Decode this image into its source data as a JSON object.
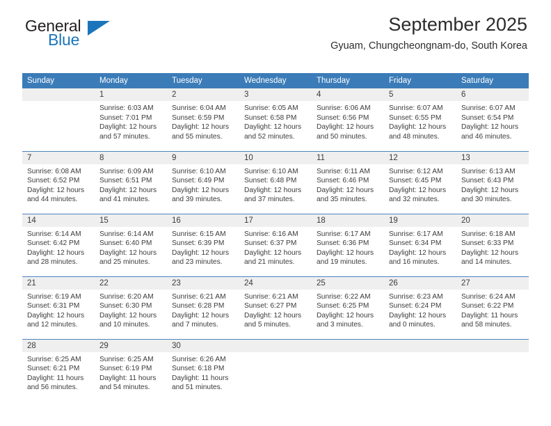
{
  "logo": {
    "word_one": "General",
    "word_two": "Blue",
    "triangle_icon": "triangle-icon",
    "brand_blue": "#1b75bb",
    "brand_dark": "#231f20"
  },
  "header": {
    "title": "September 2025",
    "subtitle": "Gyuam, Chungcheongnam-do, South Korea",
    "accent_color": "#3b7cb8",
    "daynum_band_color": "#efefef"
  },
  "weekday_headers": [
    "Sunday",
    "Monday",
    "Tuesday",
    "Wednesday",
    "Thursday",
    "Friday",
    "Saturday"
  ],
  "weeks": [
    [
      {
        "day": "",
        "sunrise": "",
        "sunset": "",
        "daylight_line1": "",
        "daylight_line2": "",
        "empty": true
      },
      {
        "day": "1",
        "sunrise": "Sunrise: 6:03 AM",
        "sunset": "Sunset: 7:01 PM",
        "daylight_line1": "Daylight: 12 hours",
        "daylight_line2": "and 57 minutes."
      },
      {
        "day": "2",
        "sunrise": "Sunrise: 6:04 AM",
        "sunset": "Sunset: 6:59 PM",
        "daylight_line1": "Daylight: 12 hours",
        "daylight_line2": "and 55 minutes."
      },
      {
        "day": "3",
        "sunrise": "Sunrise: 6:05 AM",
        "sunset": "Sunset: 6:58 PM",
        "daylight_line1": "Daylight: 12 hours",
        "daylight_line2": "and 52 minutes."
      },
      {
        "day": "4",
        "sunrise": "Sunrise: 6:06 AM",
        "sunset": "Sunset: 6:56 PM",
        "daylight_line1": "Daylight: 12 hours",
        "daylight_line2": "and 50 minutes."
      },
      {
        "day": "5",
        "sunrise": "Sunrise: 6:07 AM",
        "sunset": "Sunset: 6:55 PM",
        "daylight_line1": "Daylight: 12 hours",
        "daylight_line2": "and 48 minutes."
      },
      {
        "day": "6",
        "sunrise": "Sunrise: 6:07 AM",
        "sunset": "Sunset: 6:54 PM",
        "daylight_line1": "Daylight: 12 hours",
        "daylight_line2": "and 46 minutes."
      }
    ],
    [
      {
        "day": "7",
        "sunrise": "Sunrise: 6:08 AM",
        "sunset": "Sunset: 6:52 PM",
        "daylight_line1": "Daylight: 12 hours",
        "daylight_line2": "and 44 minutes."
      },
      {
        "day": "8",
        "sunrise": "Sunrise: 6:09 AM",
        "sunset": "Sunset: 6:51 PM",
        "daylight_line1": "Daylight: 12 hours",
        "daylight_line2": "and 41 minutes."
      },
      {
        "day": "9",
        "sunrise": "Sunrise: 6:10 AM",
        "sunset": "Sunset: 6:49 PM",
        "daylight_line1": "Daylight: 12 hours",
        "daylight_line2": "and 39 minutes."
      },
      {
        "day": "10",
        "sunrise": "Sunrise: 6:10 AM",
        "sunset": "Sunset: 6:48 PM",
        "daylight_line1": "Daylight: 12 hours",
        "daylight_line2": "and 37 minutes."
      },
      {
        "day": "11",
        "sunrise": "Sunrise: 6:11 AM",
        "sunset": "Sunset: 6:46 PM",
        "daylight_line1": "Daylight: 12 hours",
        "daylight_line2": "and 35 minutes."
      },
      {
        "day": "12",
        "sunrise": "Sunrise: 6:12 AM",
        "sunset": "Sunset: 6:45 PM",
        "daylight_line1": "Daylight: 12 hours",
        "daylight_line2": "and 32 minutes."
      },
      {
        "day": "13",
        "sunrise": "Sunrise: 6:13 AM",
        "sunset": "Sunset: 6:43 PM",
        "daylight_line1": "Daylight: 12 hours",
        "daylight_line2": "and 30 minutes."
      }
    ],
    [
      {
        "day": "14",
        "sunrise": "Sunrise: 6:14 AM",
        "sunset": "Sunset: 6:42 PM",
        "daylight_line1": "Daylight: 12 hours",
        "daylight_line2": "and 28 minutes."
      },
      {
        "day": "15",
        "sunrise": "Sunrise: 6:14 AM",
        "sunset": "Sunset: 6:40 PM",
        "daylight_line1": "Daylight: 12 hours",
        "daylight_line2": "and 25 minutes."
      },
      {
        "day": "16",
        "sunrise": "Sunrise: 6:15 AM",
        "sunset": "Sunset: 6:39 PM",
        "daylight_line1": "Daylight: 12 hours",
        "daylight_line2": "and 23 minutes."
      },
      {
        "day": "17",
        "sunrise": "Sunrise: 6:16 AM",
        "sunset": "Sunset: 6:37 PM",
        "daylight_line1": "Daylight: 12 hours",
        "daylight_line2": "and 21 minutes."
      },
      {
        "day": "18",
        "sunrise": "Sunrise: 6:17 AM",
        "sunset": "Sunset: 6:36 PM",
        "daylight_line1": "Daylight: 12 hours",
        "daylight_line2": "and 19 minutes."
      },
      {
        "day": "19",
        "sunrise": "Sunrise: 6:17 AM",
        "sunset": "Sunset: 6:34 PM",
        "daylight_line1": "Daylight: 12 hours",
        "daylight_line2": "and 16 minutes."
      },
      {
        "day": "20",
        "sunrise": "Sunrise: 6:18 AM",
        "sunset": "Sunset: 6:33 PM",
        "daylight_line1": "Daylight: 12 hours",
        "daylight_line2": "and 14 minutes."
      }
    ],
    [
      {
        "day": "21",
        "sunrise": "Sunrise: 6:19 AM",
        "sunset": "Sunset: 6:31 PM",
        "daylight_line1": "Daylight: 12 hours",
        "daylight_line2": "and 12 minutes."
      },
      {
        "day": "22",
        "sunrise": "Sunrise: 6:20 AM",
        "sunset": "Sunset: 6:30 PM",
        "daylight_line1": "Daylight: 12 hours",
        "daylight_line2": "and 10 minutes."
      },
      {
        "day": "23",
        "sunrise": "Sunrise: 6:21 AM",
        "sunset": "Sunset: 6:28 PM",
        "daylight_line1": "Daylight: 12 hours",
        "daylight_line2": "and 7 minutes."
      },
      {
        "day": "24",
        "sunrise": "Sunrise: 6:21 AM",
        "sunset": "Sunset: 6:27 PM",
        "daylight_line1": "Daylight: 12 hours",
        "daylight_line2": "and 5 minutes."
      },
      {
        "day": "25",
        "sunrise": "Sunrise: 6:22 AM",
        "sunset": "Sunset: 6:25 PM",
        "daylight_line1": "Daylight: 12 hours",
        "daylight_line2": "and 3 minutes."
      },
      {
        "day": "26",
        "sunrise": "Sunrise: 6:23 AM",
        "sunset": "Sunset: 6:24 PM",
        "daylight_line1": "Daylight: 12 hours",
        "daylight_line2": "and 0 minutes."
      },
      {
        "day": "27",
        "sunrise": "Sunrise: 6:24 AM",
        "sunset": "Sunset: 6:22 PM",
        "daylight_line1": "Daylight: 11 hours",
        "daylight_line2": "and 58 minutes."
      }
    ],
    [
      {
        "day": "28",
        "sunrise": "Sunrise: 6:25 AM",
        "sunset": "Sunset: 6:21 PM",
        "daylight_line1": "Daylight: 11 hours",
        "daylight_line2": "and 56 minutes."
      },
      {
        "day": "29",
        "sunrise": "Sunrise: 6:25 AM",
        "sunset": "Sunset: 6:19 PM",
        "daylight_line1": "Daylight: 11 hours",
        "daylight_line2": "and 54 minutes."
      },
      {
        "day": "30",
        "sunrise": "Sunrise: 6:26 AM",
        "sunset": "Sunset: 6:18 PM",
        "daylight_line1": "Daylight: 11 hours",
        "daylight_line2": "and 51 minutes."
      },
      {
        "day": "",
        "sunrise": "",
        "sunset": "",
        "daylight_line1": "",
        "daylight_line2": "",
        "empty": true
      },
      {
        "day": "",
        "sunrise": "",
        "sunset": "",
        "daylight_line1": "",
        "daylight_line2": "",
        "empty": true
      },
      {
        "day": "",
        "sunrise": "",
        "sunset": "",
        "daylight_line1": "",
        "daylight_line2": "",
        "empty": true
      },
      {
        "day": "",
        "sunrise": "",
        "sunset": "",
        "daylight_line1": "",
        "daylight_line2": "",
        "empty": true
      }
    ]
  ]
}
